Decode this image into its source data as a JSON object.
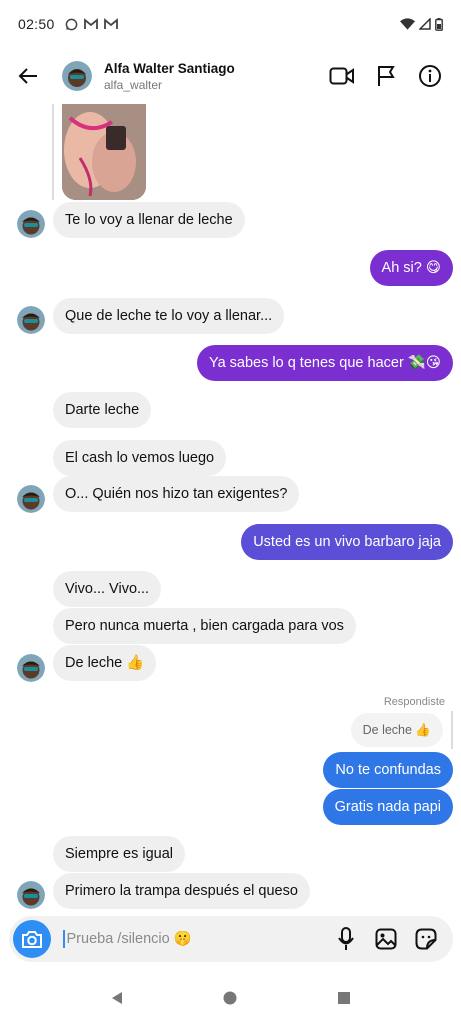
{
  "status_bar": {
    "time": "02:50"
  },
  "header": {
    "name": "Alfa Walter Santiago",
    "handle": "alfa_walter"
  },
  "messages": [
    {
      "text": "Te lo voy a llenar de leche"
    },
    {
      "text": "Ah si? 😋"
    },
    {
      "text": "Que de leche te lo voy a llenar..."
    },
    {
      "text": "Ya sabes lo q tenes que hacer 💸😘"
    },
    {
      "text": "Darte leche"
    },
    {
      "text": "El cash lo vemos luego"
    },
    {
      "text": "O... Quién nos hizo tan exigentes?"
    },
    {
      "text": "Usted es un vivo barbaro jaja"
    },
    {
      "text": "Vivo... Vivo..."
    },
    {
      "text": "Pero nunca muerta , bien cargada para vos"
    },
    {
      "text": "De leche 👍"
    },
    {
      "text": "No te confundas"
    },
    {
      "text": "Gratis nada papi"
    },
    {
      "text": "Siempre es igual"
    },
    {
      "text": "Primero la trampa después el queso"
    }
  ],
  "reply": {
    "label": "Respondiste",
    "quoted": "De leche 👍"
  },
  "composer": {
    "placeholder": "Prueba /silencio 🤫"
  },
  "colors": {
    "outgoing_purple": "#7b2fd1",
    "outgoing_blue": "#2f76e6",
    "incoming": "#efefef",
    "camera": "#2f8ef3"
  }
}
